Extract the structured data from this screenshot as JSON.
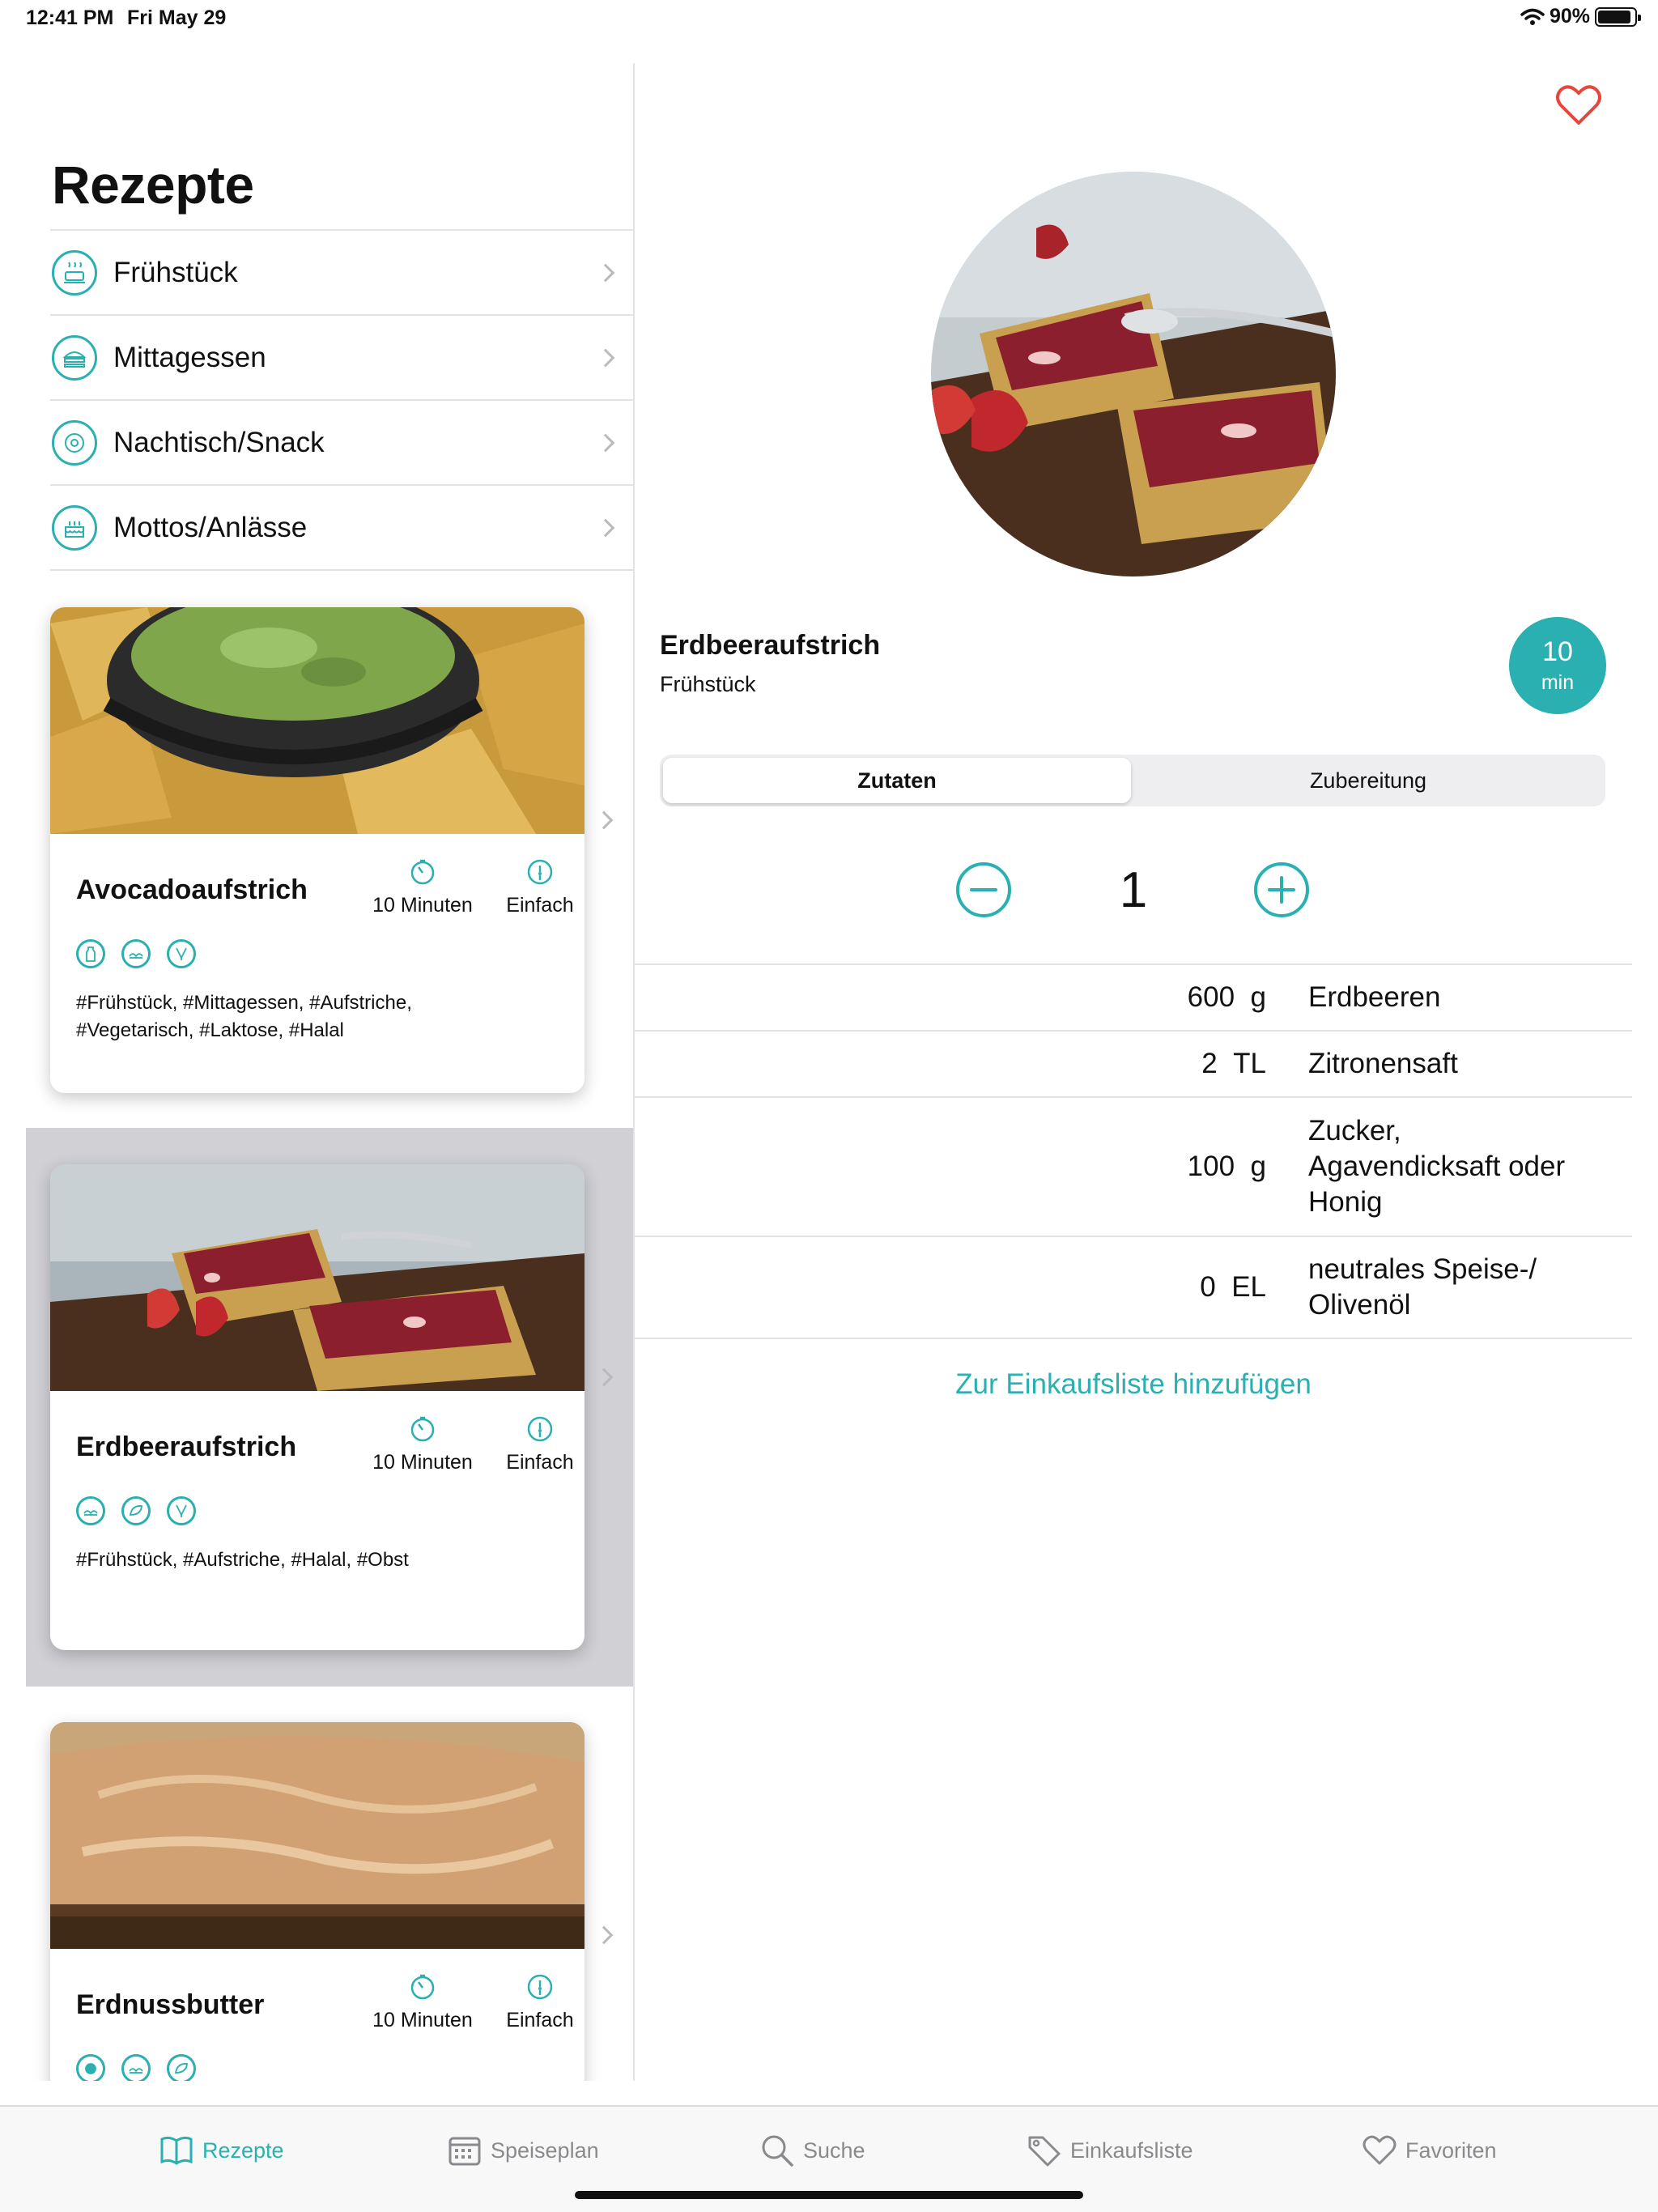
{
  "status_bar": {
    "time": "12:41 PM",
    "date": "Fri May 29",
    "battery": "90%"
  },
  "master": {
    "title": "Rezepte",
    "categories": [
      {
        "label": "Frühstück",
        "icon": "breakfast-icon"
      },
      {
        "label": "Mittagessen",
        "icon": "lunch-icon"
      },
      {
        "label": "Nachtisch/Snack",
        "icon": "dessert-icon"
      },
      {
        "label": "Mottos/Anlässe",
        "icon": "cake-icon"
      }
    ],
    "recipes": [
      {
        "title": "Avocadoaufstrich",
        "time": "10 Minuten",
        "difficulty": "Einfach",
        "tags": "#Frühstück, #Mittagessen, #Aufstriche, #Vegetarisch, #Laktose, #Halal",
        "selected": false
      },
      {
        "title": "Erdbeeraufstrich",
        "time": "10 Minuten",
        "difficulty": "Einfach",
        "tags": "#Frühstück, #Aufstriche, #Halal, #Obst",
        "selected": true
      },
      {
        "title": "Erdnussbutter",
        "time": "10 Minuten",
        "difficulty": "Einfach",
        "tags": "",
        "selected": false
      }
    ]
  },
  "detail": {
    "title": "Erdbeeraufstrich",
    "category": "Frühstück",
    "time_value": "10",
    "time_unit": "min",
    "segments": {
      "active": "Zutaten",
      "inactive": "Zubereitung"
    },
    "servings": "1",
    "ingredients": [
      {
        "amount": "600",
        "unit": "g",
        "name": "Erdbeeren"
      },
      {
        "amount": "2",
        "unit": "TL",
        "name": "Zitronensaft"
      },
      {
        "amount": "100",
        "unit": "g",
        "name": "Zucker, Agavendicksaft oder Honig"
      },
      {
        "amount": "0",
        "unit": "EL",
        "name": "neutrales Speise-/ Olivenöl"
      }
    ],
    "shopping_link": "Zur Einkaufsliste hinzufügen"
  },
  "tabbar": {
    "items": [
      {
        "label": "Rezepte",
        "icon": "book-icon",
        "active": true
      },
      {
        "label": "Speiseplan",
        "icon": "calendar-icon",
        "active": false
      },
      {
        "label": "Suche",
        "icon": "search-icon",
        "active": false
      },
      {
        "label": "Einkaufsliste",
        "icon": "tag-icon",
        "active": false
      },
      {
        "label": "Favoriten",
        "icon": "heart-icon",
        "active": false
      }
    ]
  },
  "colors": {
    "accent": "#2ab0b0",
    "favorite": "#e8453c",
    "selected_row": "#d0d0d5"
  }
}
